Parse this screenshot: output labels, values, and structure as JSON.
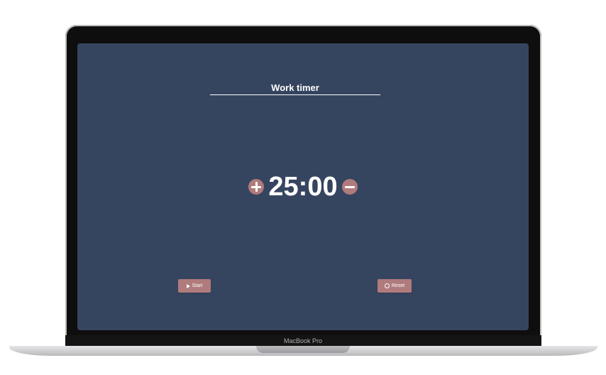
{
  "app": {
    "title": "Work timer",
    "time": "25:00"
  },
  "controls": {
    "increase_icon": "plus-circle-icon",
    "decrease_icon": "minus-circle-icon",
    "start_label": "Start",
    "reset_label": "Reset",
    "start_icon": "play-icon",
    "reset_icon": "reset-icon"
  },
  "device": {
    "model_label": "MacBook Pro"
  },
  "colors": {
    "screen_background": "#36455f",
    "accent": "#b07b7c",
    "text": "#ffffff"
  }
}
